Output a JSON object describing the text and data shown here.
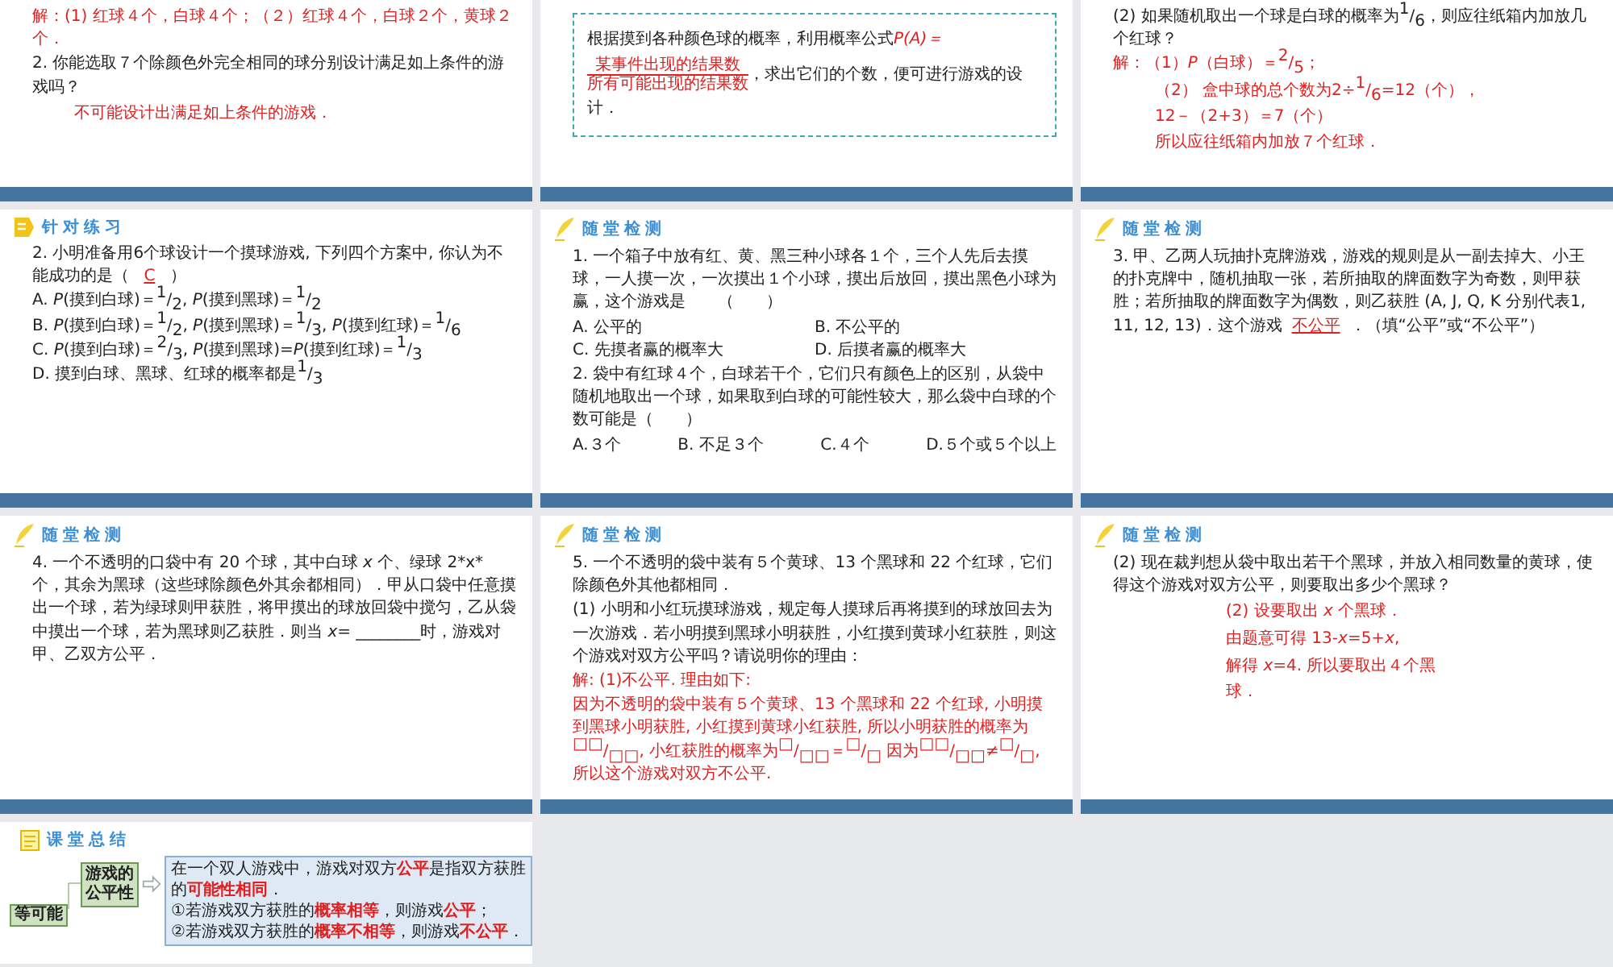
{
  "slides": [
    {
      "blocks": [
        {
          "kind": "answer",
          "text": "解：(1) 红球４个，白球４个；（２）红球４个，白球２个，黄球２个．"
        },
        {
          "kind": "question",
          "text": "2. 你能选取７个除颜色外完全相同的球分别设计满足如上条件的游戏吗？"
        },
        {
          "kind": "answer_indent",
          "text": "不可能设计出满足如上条件的游戏．"
        }
      ]
    },
    {
      "blocks": [
        {
          "kind": "formula",
          "before": "根据摸到各种颜色球的概率，利用概率公式",
          "lhs": "P(A)＝",
          "numerator": "某事件出现的结果数",
          "denominator": "所有可能出现的结果数",
          "after": "，求出它们的个数，便可进行游戏的设计．"
        }
      ]
    },
    {
      "blocks": [
        {
          "kind": "question",
          "text": "(2) 如果随机取出一个球是白球的概率为$^{1}$/$_{6}$，则应往纸箱内加放几个红球？"
        },
        {
          "kind": "answer",
          "text": "解：（1）*P*（白球）＝$^{2}$/$_{5}$；"
        },
        {
          "kind": "answer_indent",
          "text": "（2） 盒中球的总个数为2÷$^{1}$/$_{6}$=12（个），"
        },
        {
          "kind": "answer_indent",
          "text": "12－（2+3）＝7（个）"
        },
        {
          "kind": "answer_indent",
          "text": "所以应往纸箱内加放７个红球．"
        }
      ]
    },
    {
      "header": {
        "title": "针对练习",
        "kind": "practice"
      },
      "blocks": [
        {
          "kind": "question",
          "text": "2. 小明准备用6个球设计一个摸球游戏, 下列四个方案中, 你认为不能成功的是（ **C** ）"
        },
        {
          "kind": "question",
          "text": "A. *P*(摸到白球)＝$^{1}$/$_{2}$, *P*(摸到黑球)＝$^{1}$/$_{2}$"
        },
        {
          "kind": "question",
          "text": "B. *P*(摸到白球)＝$^{1}$/$_{2}$, *P*(摸到黑球)＝$^{1}$/$_{3}$, *P*(摸到红球)＝$^{1}$/$_{6}$"
        },
        {
          "kind": "question",
          "text": "C. *P*(摸到白球)＝$^{2}$/$_{3}$, *P*(摸到黑球)=*P*(摸到红球)＝$^{1}$/$_{3}$"
        },
        {
          "kind": "question",
          "text": "D. 摸到白球、黑球、红球的概率都是$^{1}$/$_{3}$"
        }
      ]
    },
    {
      "header": {
        "title": "随堂检测",
        "kind": "check"
      },
      "blocks": [
        {
          "kind": "question",
          "text": "1. 一个箱子中放有红、黄、黑三种小球各１个，三个人先后去摸球，一人摸一次，一次摸出１个小球，摸出后放回，摸出黑色小球为赢，这个游戏是　　（　　）"
        },
        {
          "kind": "choices_grid",
          "items": [
            "A. 公平的",
            "B. 不公平的",
            "C. 先摸者赢的概率大",
            "D. 后摸者赢的概率大"
          ]
        },
        {
          "kind": "question",
          "text": "2. 袋中有红球４个，白球若干个，它们只有颜色上的区别，从袋中随机地取出一个球，如果取到白球的可能性较大，那么袋中白球的个数可能是（　　）"
        },
        {
          "kind": "choices_row",
          "items": [
            "A.３个",
            "B. 不足３个",
            "C.４个",
            "D.５个或５个以上"
          ]
        }
      ]
    },
    {
      "header": {
        "title": "随堂检测",
        "kind": "check"
      },
      "blocks": [
        {
          "kind": "question",
          "text": "3. 甲、乙两人玩抽扑克牌游戏，游戏的规则是从一副去掉大、小王的扑克牌中，随机抽取一张，若所抽取的牌面数字为奇数，则甲获胜；若所抽取的牌面数字为偶数，则乙获胜 (A, J, Q, K 分别代表1, 11, 12, 13)．这个游戏**不公平**．（填“公平”或“不公平”）"
        }
      ]
    },
    {
      "header": {
        "title": "随堂检测",
        "kind": "check"
      },
      "blocks": [
        {
          "kind": "question",
          "text": "4. 一个不透明的口袋中有 20 个球，其中白球 *x* 个、绿球 2*x* 个，其余为黑球（这些球除颜色外其余都相同）．甲从口袋中任意摸出一个球，若为绿球则甲获胜，将甲摸出的球放回袋中搅匀，乙从袋中摸出一个球，若为黑球则乙获胜．则当 *x*= ________时，游戏对甲、乙双方公平．"
        }
      ]
    },
    {
      "header": {
        "title": "随堂检测",
        "kind": "check"
      },
      "blocks": [
        {
          "kind": "question",
          "text": "5. 一个不透明的袋中装有５个黄球、13 个黑球和 22 个红球，它们除颜色外其他都相同．"
        },
        {
          "kind": "question",
          "text": "(1) 小明和小红玩摸球游戏，规定每人摸球后再将摸到的球放回去为一次游戏．若小明摸到黑球小明获胜，小红摸到黄球小红获胜，则这个游戏对双方公平吗？请说明你的理由："
        },
        {
          "kind": "answer",
          "text": "解: (1)不公平. 理由如下:"
        },
        {
          "kind": "answer",
          "text": "因为不透明的袋中装有５个黄球、13 个黑球和 22 个红球, 小明摸到黑球小明获胜, 小红摸到黄球小红获胜, 所以小明获胜的概率为$^{□□}$/$_{□□}$, 小红获胜的概率为$^{□}$/$_{□□}$＝$^{□}$/$_{□}$ 因为$^{□□}$/$_{□□}$≠$^{□}$/$_{□}$, 所以这个游戏对双方不公平."
        }
      ]
    },
    {
      "header": {
        "title": "随堂检测",
        "kind": "check"
      },
      "blocks": [
        {
          "kind": "question",
          "text": "(2) 现在裁判想从袋中取出若干个黑球，并放入相同数量的黄球，使得这个游戏对双方公平，则要取出多少个黑球？"
        },
        {
          "kind": "answer_center",
          "text": "(2) 设要取出 *x* 个黑球．"
        },
        {
          "kind": "answer_center",
          "text": "由题意可得 13-*x*=5+*x*,"
        },
        {
          "kind": "answer_center",
          "text": "解得 *x*=4. 所以要取出４个黑球．"
        }
      ]
    },
    {
      "header": {
        "title": "课堂总结",
        "kind": "summary"
      },
      "blocks": [
        {
          "kind": "summary",
          "root": "等可能",
          "node": "游戏的公平性",
          "lines": [
            "在一个双人游戏中，游戏对双方**公平**是指双方获胜的**可能性相同**．",
            "①若游戏双方获胜的**概率相等**，则游戏**公平**；",
            "②若游戏双方获胜的**概率不相等**，则游戏**不公平**．"
          ]
        }
      ]
    }
  ]
}
